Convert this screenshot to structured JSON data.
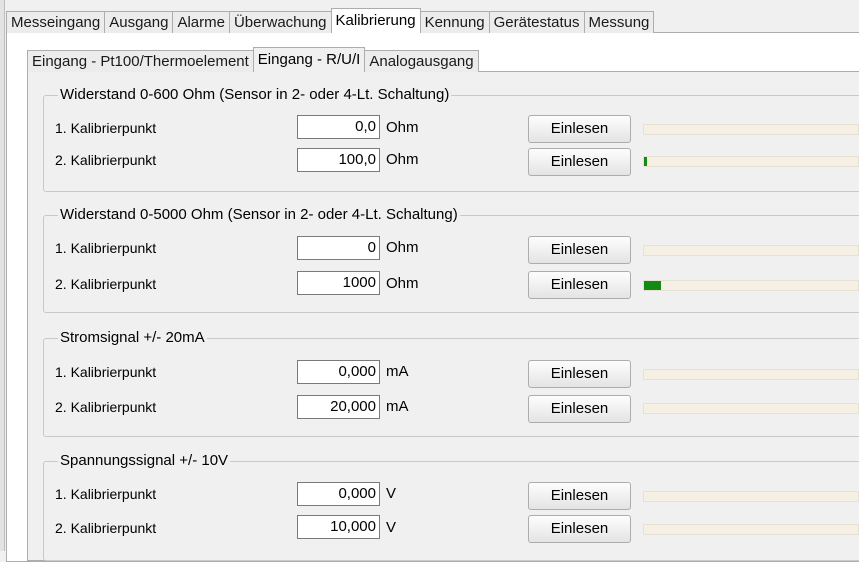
{
  "tabs": [
    "Messeingang",
    "Ausgang",
    "Alarme",
    "Überwachung",
    "Kalibrierung",
    "Kennung",
    "Gerätestatus",
    "Messung"
  ],
  "active_tab": 4,
  "subtabs": [
    "Eingang - Pt100/Thermoelement",
    "Eingang - R/U/I",
    "Analogausgang"
  ],
  "active_subtab": 1,
  "colors": {
    "progress_fill": "#138a13",
    "bar_track": "#f6f0e4"
  },
  "groups": [
    {
      "title": "Widerstand 0-600 Ohm (Sensor in 2- oder 4-Lt. Schaltung)",
      "rows": [
        {
          "label": "1. Kalibrierpunkt",
          "value": "0,0",
          "unit": "Ohm",
          "button": "Einlesen",
          "progress": 0
        },
        {
          "label": "2. Kalibrierpunkt",
          "value": "100,0",
          "unit": "Ohm",
          "button": "Einlesen",
          "progress": 0.015
        }
      ]
    },
    {
      "title": "Widerstand 0-5000 Ohm (Sensor in 2- oder 4-Lt. Schaltung)",
      "rows": [
        {
          "label": "1. Kalibrierpunkt",
          "value": "0",
          "unit": "Ohm",
          "button": "Einlesen",
          "progress": 0
        },
        {
          "label": "2. Kalibrierpunkt",
          "value": "1000",
          "unit": "Ohm",
          "button": "Einlesen",
          "progress": 0.08
        }
      ]
    },
    {
      "title": "Stromsignal +/- 20mA",
      "rows": [
        {
          "label": "1. Kalibrierpunkt",
          "value": "0,000",
          "unit": "mA",
          "button": "Einlesen",
          "progress": 0
        },
        {
          "label": "2. Kalibrierpunkt",
          "value": "20,000",
          "unit": "mA",
          "button": "Einlesen",
          "progress": 0
        }
      ]
    },
    {
      "title": "Spannungssignal +/- 10V",
      "rows": [
        {
          "label": "1. Kalibrierpunkt",
          "value": "0,000",
          "unit": "V",
          "button": "Einlesen",
          "progress": 0
        },
        {
          "label": "2. Kalibrierpunkt",
          "value": "10,000",
          "unit": "V",
          "button": "Einlesen",
          "progress": 0
        }
      ]
    }
  ]
}
